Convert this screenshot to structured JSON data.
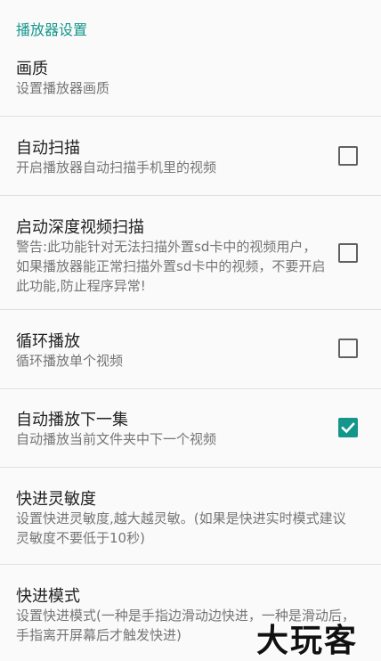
{
  "section": {
    "title": "播放器设置"
  },
  "prefs": [
    {
      "title": "画质",
      "summary": "设置播放器画质",
      "has_checkbox": false
    },
    {
      "title": "自动扫描",
      "summary": "开启播放器自动扫描手机里的视频",
      "has_checkbox": true,
      "checked": false
    },
    {
      "title": "启动深度视频扫描",
      "summary": "警告:此功能针对无法扫描外置sd卡中的视频用户，如果播放器能正常扫描外置sd卡中的视频，不要开启此功能,防止程序异常!",
      "has_checkbox": true,
      "checked": false
    },
    {
      "title": "循环播放",
      "summary": "循环播放单个视频",
      "has_checkbox": true,
      "checked": false
    },
    {
      "title": "自动播放下一集",
      "summary": "自动播放当前文件夹中下一个视频",
      "has_checkbox": true,
      "checked": true
    },
    {
      "title": "快进灵敏度",
      "summary": "设置快进灵敏度,越大越灵敏。(如果是快进实时模式建议灵敏度不要低于10秒)",
      "has_checkbox": false
    },
    {
      "title": "快进模式",
      "summary": "设置快进模式(一种是手指边滑动边快进，一种是滑动后，手指离开屏幕后才触发快进)",
      "has_checkbox": false
    }
  ],
  "watermark": "大玩客",
  "colors": {
    "accent": "#14968a",
    "divider": "#e0e0e0",
    "summary_text": "#757575",
    "background": "#fafafa"
  }
}
